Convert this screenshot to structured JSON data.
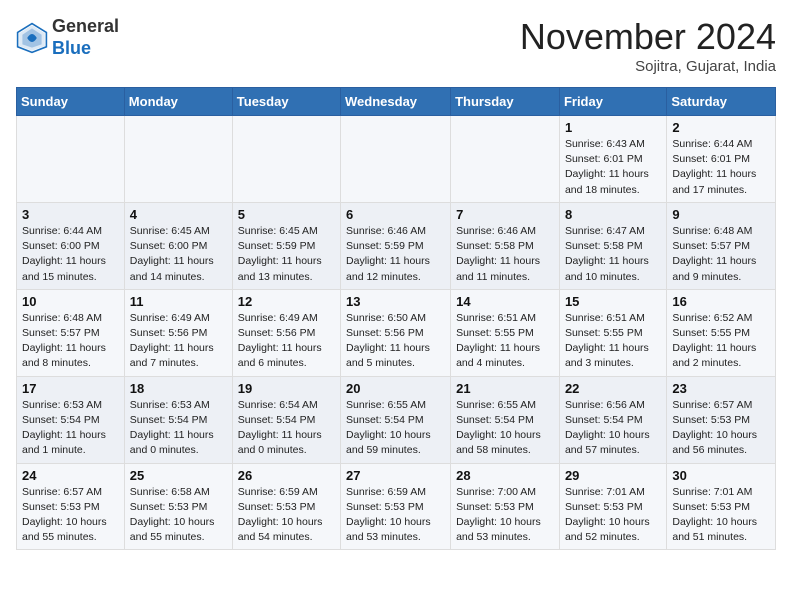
{
  "header": {
    "logo_line1": "General",
    "logo_line2": "Blue",
    "month": "November 2024",
    "location": "Sojitra, Gujarat, India"
  },
  "weekdays": [
    "Sunday",
    "Monday",
    "Tuesday",
    "Wednesday",
    "Thursday",
    "Friday",
    "Saturday"
  ],
  "weeks": [
    [
      {
        "day": "",
        "sunrise": "",
        "sunset": "",
        "daylight": ""
      },
      {
        "day": "",
        "sunrise": "",
        "sunset": "",
        "daylight": ""
      },
      {
        "day": "",
        "sunrise": "",
        "sunset": "",
        "daylight": ""
      },
      {
        "day": "",
        "sunrise": "",
        "sunset": "",
        "daylight": ""
      },
      {
        "day": "",
        "sunrise": "",
        "sunset": "",
        "daylight": ""
      },
      {
        "day": "1",
        "sunrise": "Sunrise: 6:43 AM",
        "sunset": "Sunset: 6:01 PM",
        "daylight": "Daylight: 11 hours and 18 minutes."
      },
      {
        "day": "2",
        "sunrise": "Sunrise: 6:44 AM",
        "sunset": "Sunset: 6:01 PM",
        "daylight": "Daylight: 11 hours and 17 minutes."
      }
    ],
    [
      {
        "day": "3",
        "sunrise": "Sunrise: 6:44 AM",
        "sunset": "Sunset: 6:00 PM",
        "daylight": "Daylight: 11 hours and 15 minutes."
      },
      {
        "day": "4",
        "sunrise": "Sunrise: 6:45 AM",
        "sunset": "Sunset: 6:00 PM",
        "daylight": "Daylight: 11 hours and 14 minutes."
      },
      {
        "day": "5",
        "sunrise": "Sunrise: 6:45 AM",
        "sunset": "Sunset: 5:59 PM",
        "daylight": "Daylight: 11 hours and 13 minutes."
      },
      {
        "day": "6",
        "sunrise": "Sunrise: 6:46 AM",
        "sunset": "Sunset: 5:59 PM",
        "daylight": "Daylight: 11 hours and 12 minutes."
      },
      {
        "day": "7",
        "sunrise": "Sunrise: 6:46 AM",
        "sunset": "Sunset: 5:58 PM",
        "daylight": "Daylight: 11 hours and 11 minutes."
      },
      {
        "day": "8",
        "sunrise": "Sunrise: 6:47 AM",
        "sunset": "Sunset: 5:58 PM",
        "daylight": "Daylight: 11 hours and 10 minutes."
      },
      {
        "day": "9",
        "sunrise": "Sunrise: 6:48 AM",
        "sunset": "Sunset: 5:57 PM",
        "daylight": "Daylight: 11 hours and 9 minutes."
      }
    ],
    [
      {
        "day": "10",
        "sunrise": "Sunrise: 6:48 AM",
        "sunset": "Sunset: 5:57 PM",
        "daylight": "Daylight: 11 hours and 8 minutes."
      },
      {
        "day": "11",
        "sunrise": "Sunrise: 6:49 AM",
        "sunset": "Sunset: 5:56 PM",
        "daylight": "Daylight: 11 hours and 7 minutes."
      },
      {
        "day": "12",
        "sunrise": "Sunrise: 6:49 AM",
        "sunset": "Sunset: 5:56 PM",
        "daylight": "Daylight: 11 hours and 6 minutes."
      },
      {
        "day": "13",
        "sunrise": "Sunrise: 6:50 AM",
        "sunset": "Sunset: 5:56 PM",
        "daylight": "Daylight: 11 hours and 5 minutes."
      },
      {
        "day": "14",
        "sunrise": "Sunrise: 6:51 AM",
        "sunset": "Sunset: 5:55 PM",
        "daylight": "Daylight: 11 hours and 4 minutes."
      },
      {
        "day": "15",
        "sunrise": "Sunrise: 6:51 AM",
        "sunset": "Sunset: 5:55 PM",
        "daylight": "Daylight: 11 hours and 3 minutes."
      },
      {
        "day": "16",
        "sunrise": "Sunrise: 6:52 AM",
        "sunset": "Sunset: 5:55 PM",
        "daylight": "Daylight: 11 hours and 2 minutes."
      }
    ],
    [
      {
        "day": "17",
        "sunrise": "Sunrise: 6:53 AM",
        "sunset": "Sunset: 5:54 PM",
        "daylight": "Daylight: 11 hours and 1 minute."
      },
      {
        "day": "18",
        "sunrise": "Sunrise: 6:53 AM",
        "sunset": "Sunset: 5:54 PM",
        "daylight": "Daylight: 11 hours and 0 minutes."
      },
      {
        "day": "19",
        "sunrise": "Sunrise: 6:54 AM",
        "sunset": "Sunset: 5:54 PM",
        "daylight": "Daylight: 11 hours and 0 minutes."
      },
      {
        "day": "20",
        "sunrise": "Sunrise: 6:55 AM",
        "sunset": "Sunset: 5:54 PM",
        "daylight": "Daylight: 10 hours and 59 minutes."
      },
      {
        "day": "21",
        "sunrise": "Sunrise: 6:55 AM",
        "sunset": "Sunset: 5:54 PM",
        "daylight": "Daylight: 10 hours and 58 minutes."
      },
      {
        "day": "22",
        "sunrise": "Sunrise: 6:56 AM",
        "sunset": "Sunset: 5:54 PM",
        "daylight": "Daylight: 10 hours and 57 minutes."
      },
      {
        "day": "23",
        "sunrise": "Sunrise: 6:57 AM",
        "sunset": "Sunset: 5:53 PM",
        "daylight": "Daylight: 10 hours and 56 minutes."
      }
    ],
    [
      {
        "day": "24",
        "sunrise": "Sunrise: 6:57 AM",
        "sunset": "Sunset: 5:53 PM",
        "daylight": "Daylight: 10 hours and 55 minutes."
      },
      {
        "day": "25",
        "sunrise": "Sunrise: 6:58 AM",
        "sunset": "Sunset: 5:53 PM",
        "daylight": "Daylight: 10 hours and 55 minutes."
      },
      {
        "day": "26",
        "sunrise": "Sunrise: 6:59 AM",
        "sunset": "Sunset: 5:53 PM",
        "daylight": "Daylight: 10 hours and 54 minutes."
      },
      {
        "day": "27",
        "sunrise": "Sunrise: 6:59 AM",
        "sunset": "Sunset: 5:53 PM",
        "daylight": "Daylight: 10 hours and 53 minutes."
      },
      {
        "day": "28",
        "sunrise": "Sunrise: 7:00 AM",
        "sunset": "Sunset: 5:53 PM",
        "daylight": "Daylight: 10 hours and 53 minutes."
      },
      {
        "day": "29",
        "sunrise": "Sunrise: 7:01 AM",
        "sunset": "Sunset: 5:53 PM",
        "daylight": "Daylight: 10 hours and 52 minutes."
      },
      {
        "day": "30",
        "sunrise": "Sunrise: 7:01 AM",
        "sunset": "Sunset: 5:53 PM",
        "daylight": "Daylight: 10 hours and 51 minutes."
      }
    ]
  ]
}
